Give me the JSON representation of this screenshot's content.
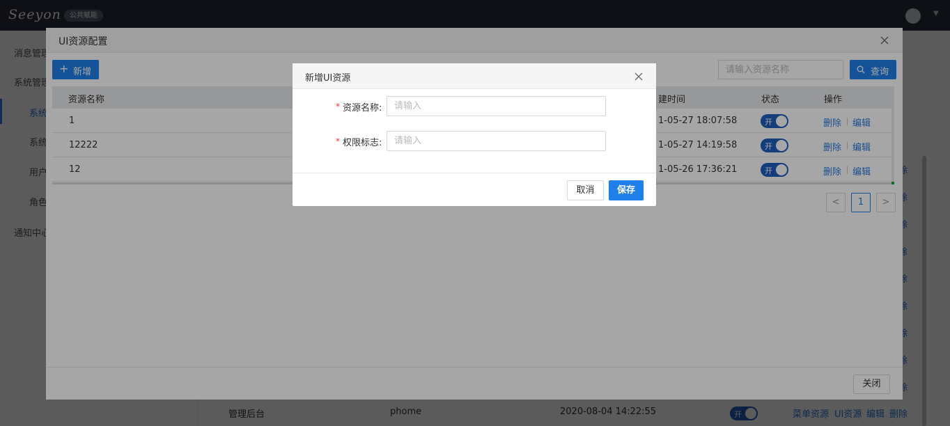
{
  "app": {
    "logo_text": "Seeyon",
    "product_badge": "公共赋能"
  },
  "sidebar": {
    "items": [
      {
        "label": "消息管理"
      },
      {
        "label": "系统管理"
      },
      {
        "label": "系统"
      },
      {
        "label": "系统"
      },
      {
        "label": "用户"
      },
      {
        "label": "角色"
      },
      {
        "label": "通知中心"
      }
    ]
  },
  "background_table": {
    "delete_label": "除",
    "row": {
      "name": "管理后台",
      "code": "phome",
      "time": "2020-08-04 14:22:55",
      "status": "开",
      "actions": [
        "菜单资源",
        "UI资源",
        "编辑",
        "删除"
      ]
    }
  },
  "config_dialog": {
    "title": "UI资源配置",
    "add_button": "新增",
    "search_placeholder": "请输入资源名称",
    "search_button": "查询",
    "columns": [
      "资源名称",
      "建时间",
      "状态",
      "操作"
    ],
    "rows": [
      {
        "name": "1",
        "time": "1-05-27 18:07:58",
        "status": "开",
        "delete": "删除",
        "edit": "编辑"
      },
      {
        "name": "12222",
        "time": "1-05-27 14:19:58",
        "status": "开",
        "delete": "删除",
        "edit": "编辑"
      },
      {
        "name": "12",
        "time": "1-05-26 17:36:21",
        "status": "开",
        "delete": "删除",
        "edit": "编辑"
      }
    ],
    "pagination": {
      "prev": "<",
      "current": "1",
      "next": ">"
    },
    "close_button": "关闭"
  },
  "add_dialog": {
    "title": "新增UI资源",
    "fields": [
      {
        "label": "资源名称:",
        "placeholder": "请输入",
        "required": "*"
      },
      {
        "label": "权限标志:",
        "placeholder": "请输入",
        "required": "*"
      }
    ],
    "cancel_button": "取消",
    "save_button": "保存"
  },
  "colors": {
    "primary": "#1f80ea",
    "topbar": "#2b3141",
    "required": "#e5383b"
  }
}
